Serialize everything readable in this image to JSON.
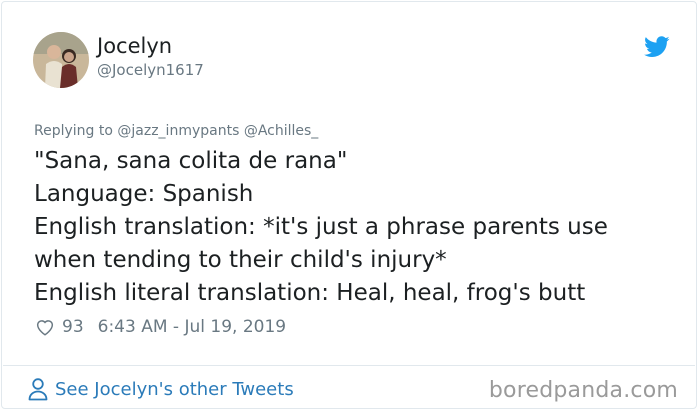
{
  "tweet": {
    "author": {
      "display_name": "Jocelyn",
      "handle": "@Jocelyn1617"
    },
    "reply_prefix": "Replying to",
    "reply_to": [
      "@jazz_inmypants",
      "@Achilles_"
    ],
    "text_lines": [
      "\"Sana, sana colita de rana\"",
      "Language: Spanish",
      "English translation: *it's just a phrase parents use",
      "when tending to their child's injury*",
      "English literal translation: Heal, heal, frog's butt"
    ],
    "likes": "93",
    "timestamp": "6:43 AM - Jul 19, 2019",
    "see_more": "See Jocelyn's other Tweets"
  },
  "watermark": "boredpanda.com",
  "colors": {
    "accent": "#1da1f2",
    "link": "#2b7bb9",
    "muted": "#697882",
    "text": "#1c2022"
  },
  "icons": {
    "bird": "twitter-bird-icon",
    "heart": "heart-icon",
    "person": "person-icon"
  }
}
